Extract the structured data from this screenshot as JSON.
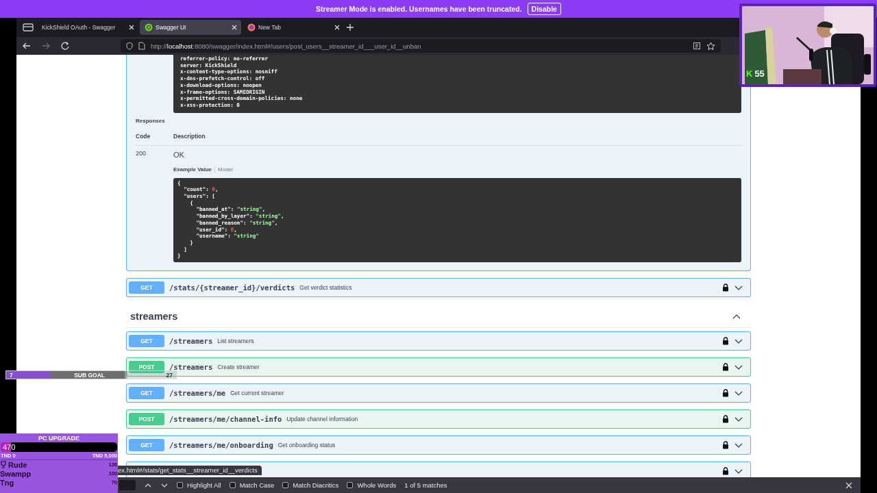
{
  "stream_banner": {
    "message": "Streamer Mode is enabled. Usernames have been truncated.",
    "button": "Disable"
  },
  "browser": {
    "tabs": [
      {
        "label": "KickShield OAuth - Swagger",
        "selected": false,
        "kind": "plain"
      },
      {
        "label": "Swagger UI",
        "selected": true,
        "kind": "swagger"
      },
      {
        "label": "New Tab",
        "selected": false,
        "kind": "browser"
      }
    ],
    "back_disabled": false,
    "forward_disabled": true,
    "url": "http://**localhost**:8080/swagger/index.html#/users/post_users__streamer_id___user_id__unban"
  },
  "headers_lines": [
    "referrer-policy: no-referrer",
    "server: KickShield",
    "x-content-type-options: nosniff",
    "x-dns-prefetch-control: off",
    "x-download-options: noopen",
    "x-frame-options: SAMEORIGIN",
    "x-permitted-cross-domain-policies: none",
    "x-xss-protection: 0"
  ],
  "responses": {
    "label": "Responses",
    "columns": [
      "Code",
      "Description"
    ],
    "rows": [
      {
        "code": "200",
        "description": "OK",
        "example_tabs": [
          {
            "label": "Example Value",
            "selected": true
          },
          {
            "label": "Model",
            "selected": false
          }
        ],
        "example_lines": [
          "{",
          "  \"count\": 0,",
          "  \"users\": [",
          "    {",
          "      \"banned_at\": \"string\",",
          "      \"banned_by_layer\": \"string\",",
          "      \"banned_reason\": \"string\",",
          "      \"user_id\": 0,",
          "      \"username\": \"string\"",
          "    }",
          "  ]",
          "}"
        ]
      }
    ]
  },
  "operations_before": [
    {
      "method": "GET",
      "path": "/stats/{streamer_id}/verdicts",
      "summary": "Get verdict statistics",
      "locked": true,
      "expanded": false
    }
  ],
  "section": {
    "title": "streamers",
    "expanded": true,
    "operations": [
      {
        "method": "GET",
        "path": "/streamers",
        "summary": "List streamers",
        "locked": true,
        "expanded": false
      },
      {
        "method": "POST",
        "path": "/streamers",
        "summary": "Create streamer",
        "locked": true,
        "expanded": false
      },
      {
        "method": "GET",
        "path": "/streamers/me",
        "summary": "Get current streamer",
        "locked": true,
        "expanded": false
      },
      {
        "method": "POST",
        "path": "/streamers/me/channel-info",
        "summary": "Update channel information",
        "locked": true,
        "expanded": false
      },
      {
        "method": "GET",
        "path": "/streamers/me/onboarding",
        "summary": "Get onboarding status",
        "locked": true,
        "expanded": false
      },
      {
        "kind": "hidden",
        "locked": true,
        "expanded": false
      }
    ]
  },
  "link_status": "ex.html#/stats/get_stats__streamer_id__verdicts",
  "find_bar": {
    "options": [
      {
        "label": "Highlight All",
        "checked": false
      },
      {
        "label": "Match Case",
        "checked": false
      },
      {
        "label": "Match Diacritics",
        "checked": false
      },
      {
        "label": "Whole Words",
        "checked": false
      }
    ],
    "result": "1 of 5 matches"
  },
  "webcam": {
    "kind": "picture",
    "badge_letter": "K",
    "badge_count": "55"
  },
  "sub_goal": {
    "current": "7",
    "label": "SUB GOAL",
    "target": "27",
    "level": 0.26
  },
  "pc_upgrade": {
    "title": "PC UPGRADE",
    "amount": "470",
    "level": 0.09,
    "min_label": "TND 0",
    "max_label": "TND 5,000",
    "leaders": [
      {
        "name": "Rude",
        "amount": "120",
        "top": true
      },
      {
        "name": "Swampp",
        "amount": "100",
        "top": false
      },
      {
        "name": "Tng",
        "amount": "70",
        "top": false
      }
    ]
  }
}
